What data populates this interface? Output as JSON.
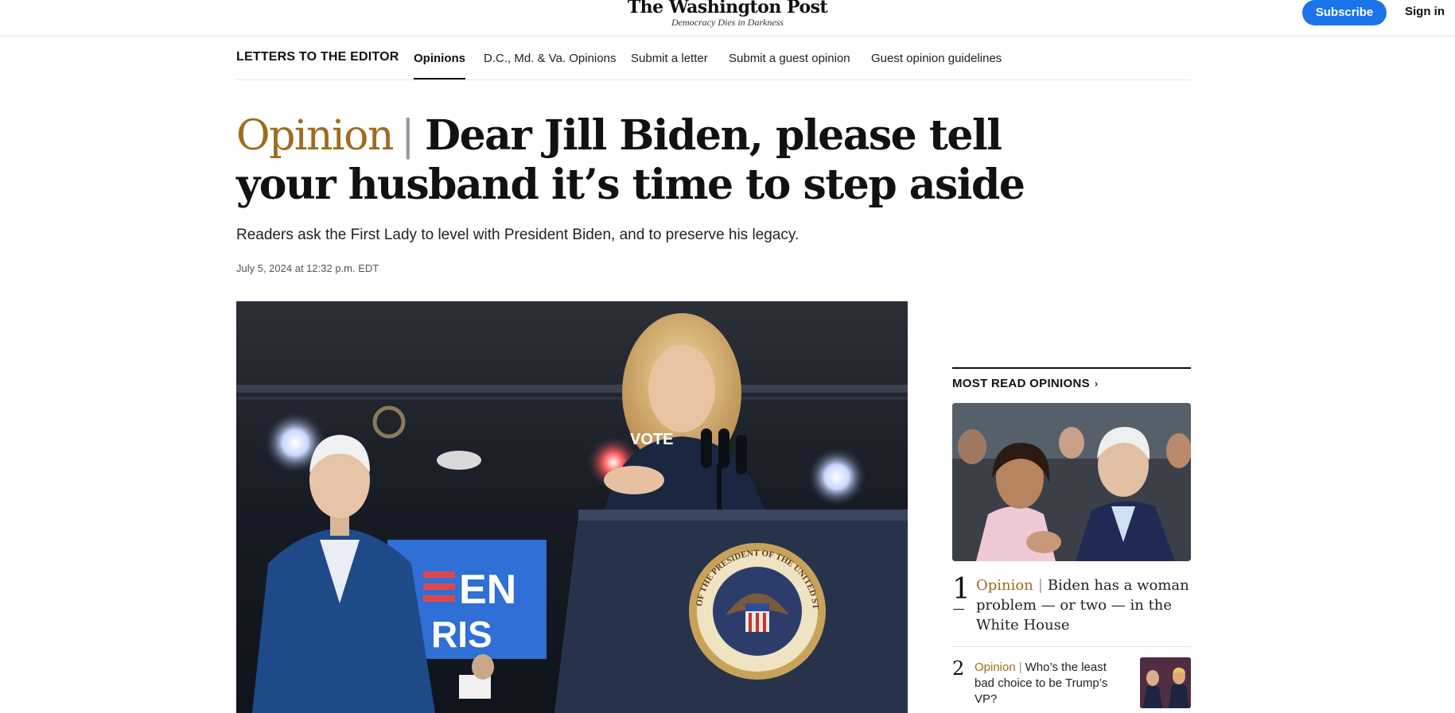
{
  "masthead": {
    "logo": "The Washington Post",
    "tagline": "Democracy Dies in Darkness",
    "subscribe_label": "Subscribe",
    "signin_label": "Sign in"
  },
  "section_nav": {
    "section_label": "LETTERS TO THE EDITOR",
    "items": [
      {
        "label": "Opinions",
        "active": true
      },
      {
        "label": "D.C., Md. & Va. Opinions",
        "active": false
      },
      {
        "label": "Submit a letter",
        "active": false
      },
      {
        "label": "Submit a guest opinion",
        "active": false
      },
      {
        "label": "Guest opinion guidelines",
        "active": false
      }
    ]
  },
  "article": {
    "kicker": "Opinion",
    "separator": "|",
    "headline": "Dear Jill Biden, please tell your husband it’s time to step aside",
    "dek": "Readers ask the First Lady to level with President Biden, and to preserve his legacy.",
    "timestamp": "July 5, 2024 at 12:32 p.m. EDT",
    "lead_photo": {
      "podium_seal_text": "SEAL OF THE PRESIDENT OF THE UNITED STATES",
      "shirt_text": "VOTE",
      "banner_text_1": "EN",
      "banner_text_2": "RIS"
    }
  },
  "most_read": {
    "title": "MOST READ OPINIONS",
    "chevron_icon": "chevron-right-icon",
    "items": [
      {
        "rank": "1",
        "kicker": "Opinion",
        "separator": "|",
        "headline": "Biden has a woman problem — or two — in the White House"
      },
      {
        "rank": "2",
        "kicker": "Opinion",
        "separator": "|",
        "headline": "Who’s the least bad choice to be Trump’s VP?"
      }
    ]
  },
  "colors": {
    "accent_opinion": "#9f6b1e",
    "subscribe_blue": "#1a73e8",
    "text": "#111111"
  }
}
